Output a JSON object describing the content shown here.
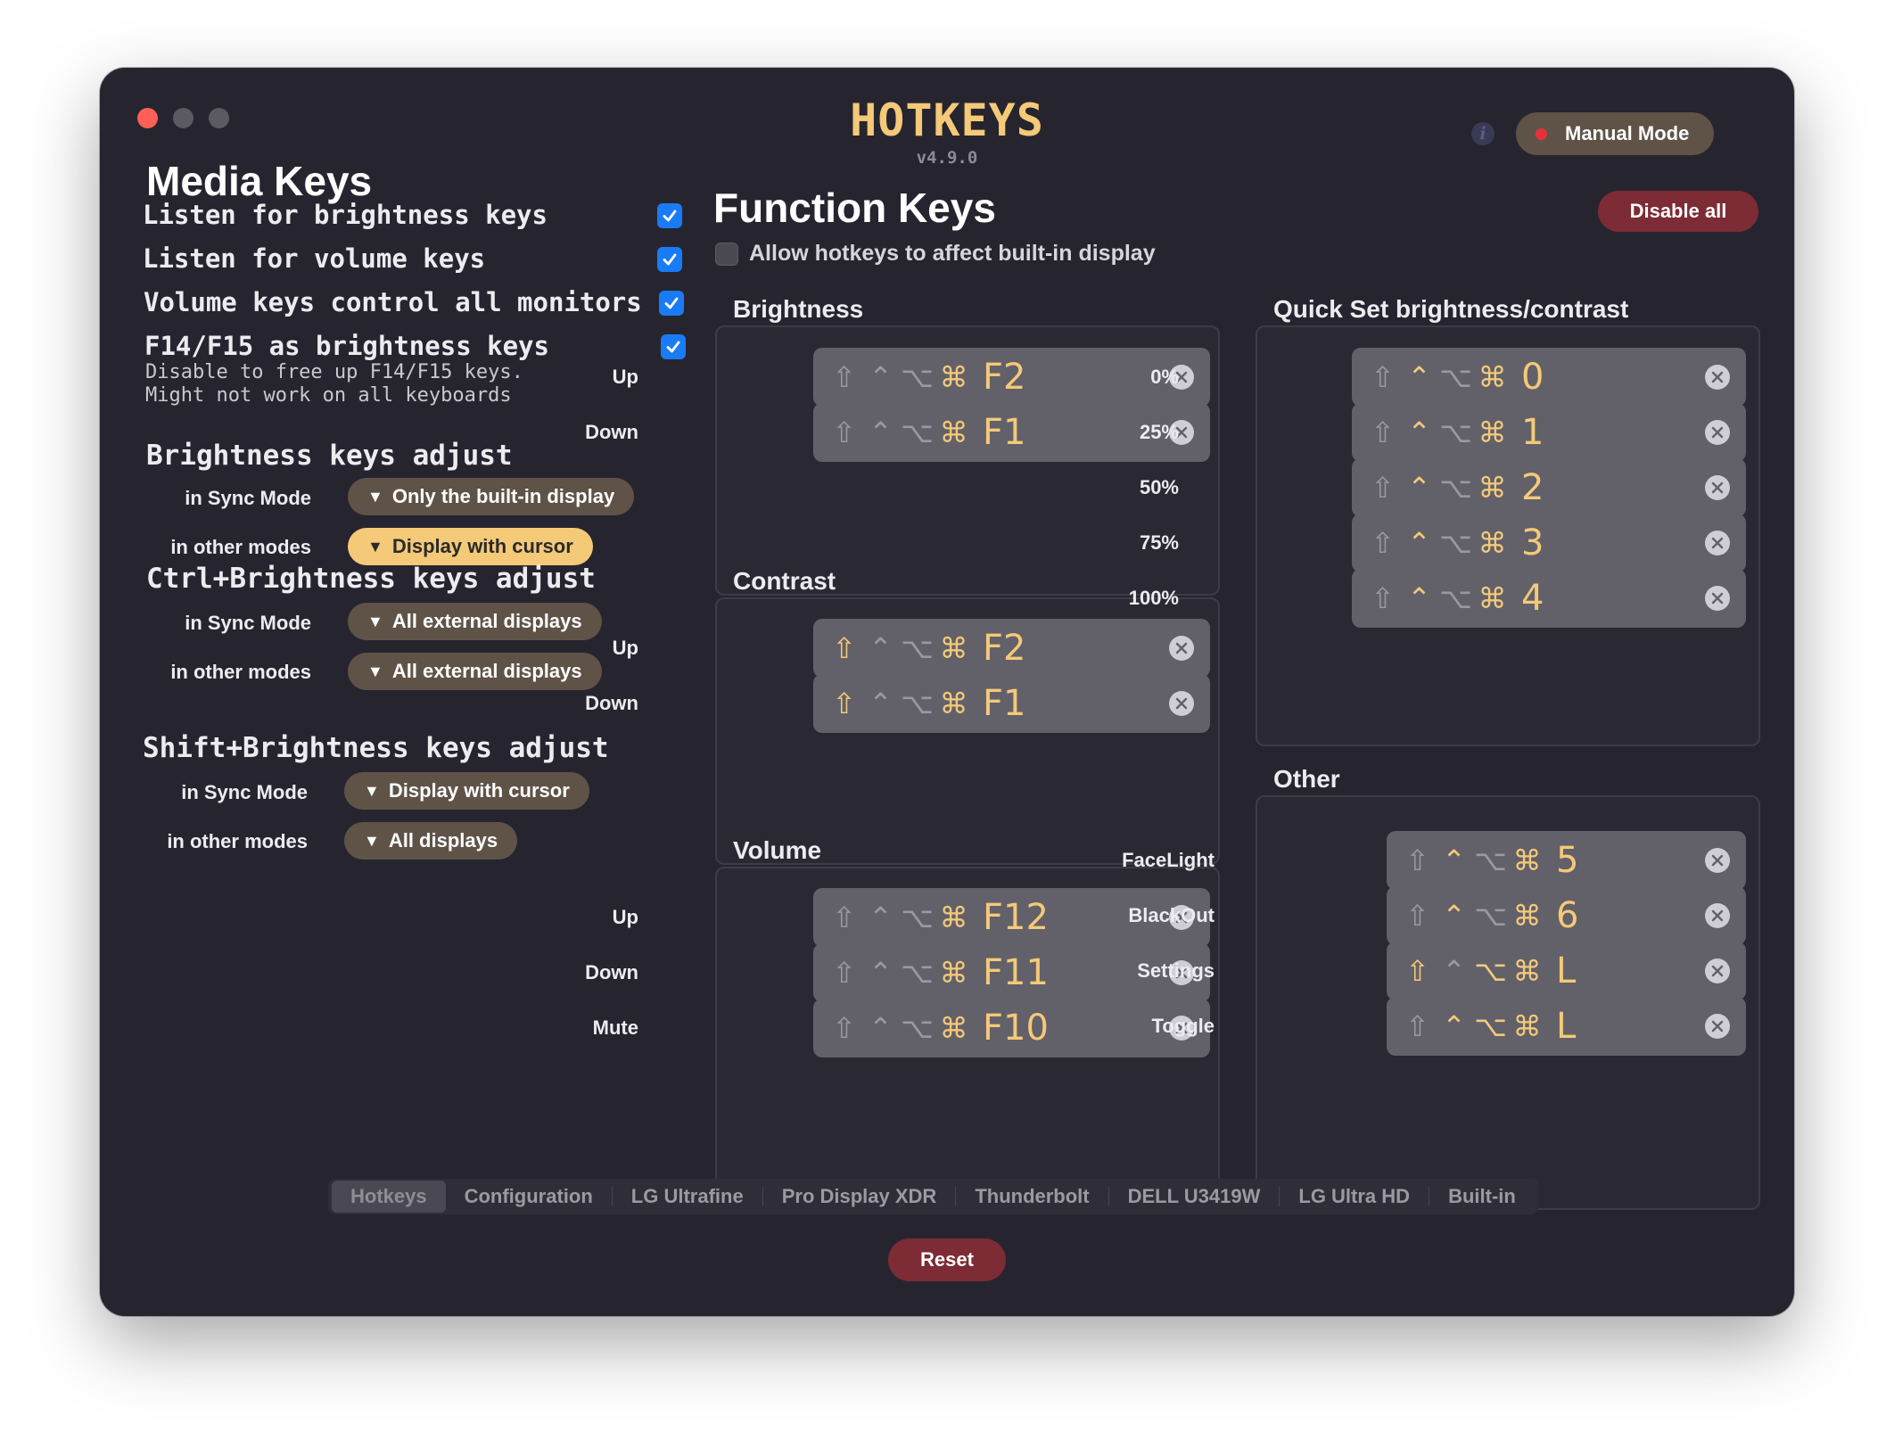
{
  "app": {
    "title": "HOTKEYS",
    "version": "v4.9.0"
  },
  "header": {
    "info_icon": "i",
    "mode_button": "Manual Mode",
    "mode_color": "#e8303b"
  },
  "media_keys": {
    "title": "Media Keys",
    "options": [
      {
        "label": "Listen for brightness keys",
        "checked": true
      },
      {
        "label": "Listen for volume keys",
        "checked": true
      },
      {
        "label": "Volume keys control all monitors",
        "checked": true
      },
      {
        "label": "F14/F15 as brightness keys",
        "checked": true,
        "sub1": "Disable to free up F14/F15 keys.",
        "sub2": "Might not work on all keyboards"
      }
    ],
    "sections": [
      {
        "title": "Brightness keys adjust",
        "sync_label": "in Sync Mode",
        "sync_value": "Only the built-in display",
        "other_label": "in other modes",
        "other_value": "Display with cursor"
      },
      {
        "title": "Ctrl+Brightness keys adjust",
        "sync_label": "in Sync Mode",
        "sync_value": "All external displays",
        "other_label": "in other modes",
        "other_value": "All external displays"
      },
      {
        "title": "Shift+Brightness keys adjust",
        "sync_label": "in Sync Mode",
        "sync_value": "Display with cursor",
        "other_label": "in other modes",
        "other_value": "All displays"
      }
    ]
  },
  "function_keys": {
    "title": "Function Keys",
    "allow_label": "Allow hotkeys to affect built-in display",
    "allow_checked": false,
    "disable_all": "Disable all",
    "groups": {
      "brightness": {
        "title": "Brightness",
        "rows": [
          {
            "label": "Up",
            "mods": "⇧⌃⌥⌘",
            "key": "F2"
          },
          {
            "label": "Down",
            "mods": "⇧⌃⌥⌘",
            "key": "F1"
          }
        ]
      },
      "contrast": {
        "title": "Contrast",
        "rows": [
          {
            "label": "Up",
            "mods": "⇧⌃⌥⌘",
            "key": "F2"
          },
          {
            "label": "Down",
            "mods": "⇧⌃⌥⌘",
            "key": "F1"
          }
        ]
      },
      "volume": {
        "title": "Volume",
        "rows": [
          {
            "label": "Up",
            "mods": "⇧⌃⌥⌘",
            "key": "F12"
          },
          {
            "label": "Down",
            "mods": "⇧⌃⌥⌘",
            "key": "F11"
          },
          {
            "label": "Mute",
            "mods": "⇧⌃⌥⌘",
            "key": "F10"
          }
        ]
      },
      "quickset": {
        "title": "Quick Set brightness/contrast",
        "rows": [
          {
            "label": "0%",
            "mods": "⇧⌃⌥⌘",
            "key": "0"
          },
          {
            "label": "25%",
            "mods": "⇧⌃⌥⌘",
            "key": "1"
          },
          {
            "label": "50%",
            "mods": "⇧⌃⌥⌘",
            "key": "2"
          },
          {
            "label": "75%",
            "mods": "⇧⌃⌥⌘",
            "key": "3"
          },
          {
            "label": "100%",
            "mods": "⇧⌃⌥⌘",
            "key": "4"
          }
        ]
      },
      "other": {
        "title": "Other",
        "rows": [
          {
            "label": "FaceLight",
            "mods": "⇧⌃⌥⌘",
            "key": "5"
          },
          {
            "label": "BlackOut",
            "mods": "⇧⌃⌥⌘",
            "key": "6"
          },
          {
            "label": "Settings",
            "mods": "⇧⌃⌥⌘",
            "key": "L"
          },
          {
            "label": "Toggle",
            "mods": "⇧⌃⌥⌘",
            "key": "L"
          }
        ]
      }
    }
  },
  "tabs": [
    "Hotkeys",
    "Configuration",
    "LG Ultrafine",
    "Pro Display XDR",
    "Thunderbolt",
    "DELL U3419W",
    "LG Ultra HD",
    "Built-in"
  ],
  "active_tab": "Hotkeys",
  "reset_label": "Reset",
  "colors": {
    "accent": "#f4c978",
    "window_bg": "#26252f",
    "danger": "#7d2b34",
    "checkbox": "#1a7bf7"
  }
}
